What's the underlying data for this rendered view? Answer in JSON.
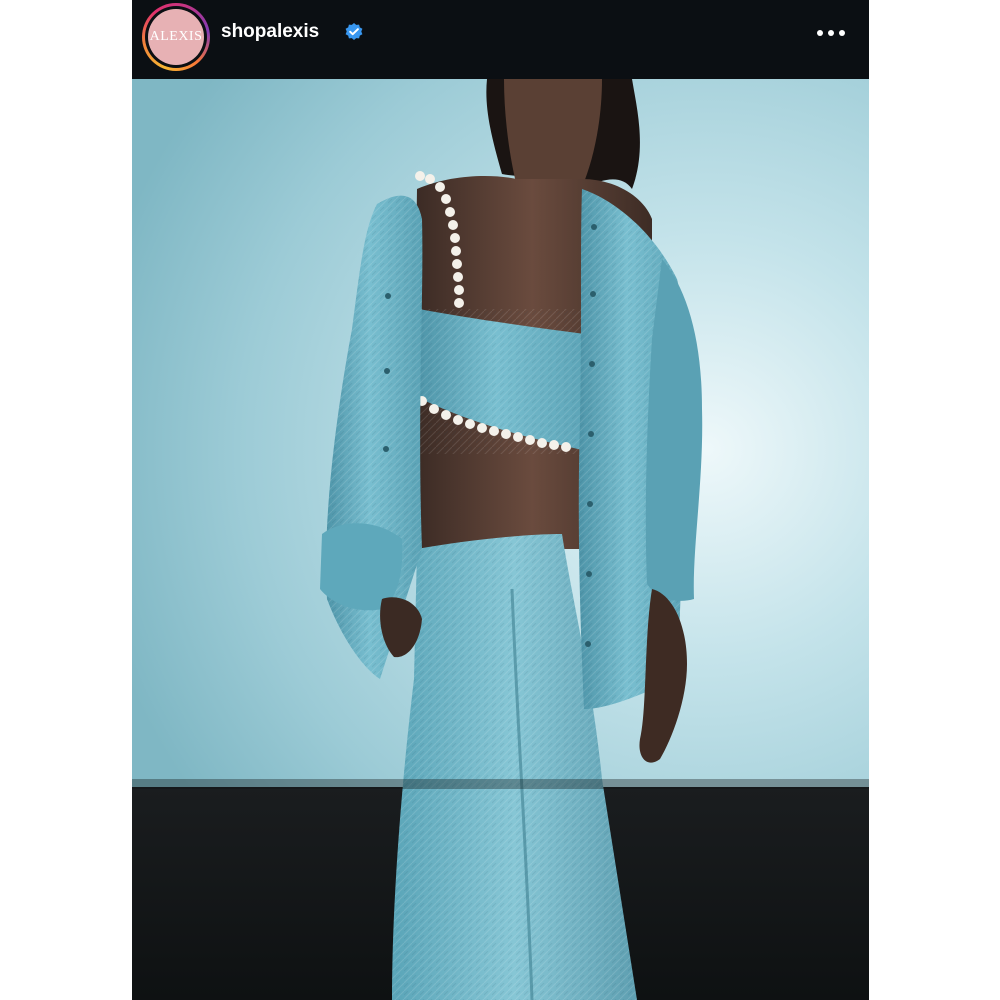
{
  "post": {
    "account": {
      "username": "shopalexis",
      "avatar_text": "ALEXIS",
      "verified": true
    },
    "menu_icon": "more-horizontal-icon",
    "image": {
      "subject": "fashion-photo",
      "palette": {
        "backdrop": "#b9dde6",
        "floor": "#121516",
        "outfit": "#6cb4c7",
        "header_bg": "#0b0f13",
        "verified_badge": "#3897f0"
      }
    }
  }
}
